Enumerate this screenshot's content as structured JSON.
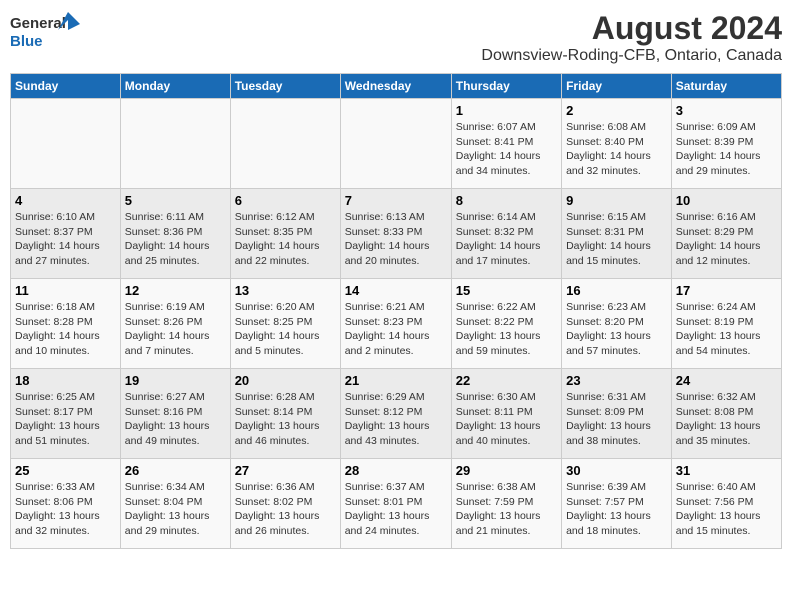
{
  "logo": {
    "line1": "General",
    "line2": "Blue"
  },
  "title": "August 2024",
  "subtitle": "Downsview-Roding-CFB, Ontario, Canada",
  "headers": [
    "Sunday",
    "Monday",
    "Tuesday",
    "Wednesday",
    "Thursday",
    "Friday",
    "Saturday"
  ],
  "weeks": [
    [
      {
        "day": "",
        "info": ""
      },
      {
        "day": "",
        "info": ""
      },
      {
        "day": "",
        "info": ""
      },
      {
        "day": "",
        "info": ""
      },
      {
        "day": "1",
        "info": "Sunrise: 6:07 AM\nSunset: 8:41 PM\nDaylight: 14 hours and 34 minutes."
      },
      {
        "day": "2",
        "info": "Sunrise: 6:08 AM\nSunset: 8:40 PM\nDaylight: 14 hours and 32 minutes."
      },
      {
        "day": "3",
        "info": "Sunrise: 6:09 AM\nSunset: 8:39 PM\nDaylight: 14 hours and 29 minutes."
      }
    ],
    [
      {
        "day": "4",
        "info": "Sunrise: 6:10 AM\nSunset: 8:37 PM\nDaylight: 14 hours and 27 minutes."
      },
      {
        "day": "5",
        "info": "Sunrise: 6:11 AM\nSunset: 8:36 PM\nDaylight: 14 hours and 25 minutes."
      },
      {
        "day": "6",
        "info": "Sunrise: 6:12 AM\nSunset: 8:35 PM\nDaylight: 14 hours and 22 minutes."
      },
      {
        "day": "7",
        "info": "Sunrise: 6:13 AM\nSunset: 8:33 PM\nDaylight: 14 hours and 20 minutes."
      },
      {
        "day": "8",
        "info": "Sunrise: 6:14 AM\nSunset: 8:32 PM\nDaylight: 14 hours and 17 minutes."
      },
      {
        "day": "9",
        "info": "Sunrise: 6:15 AM\nSunset: 8:31 PM\nDaylight: 14 hours and 15 minutes."
      },
      {
        "day": "10",
        "info": "Sunrise: 6:16 AM\nSunset: 8:29 PM\nDaylight: 14 hours and 12 minutes."
      }
    ],
    [
      {
        "day": "11",
        "info": "Sunrise: 6:18 AM\nSunset: 8:28 PM\nDaylight: 14 hours and 10 minutes."
      },
      {
        "day": "12",
        "info": "Sunrise: 6:19 AM\nSunset: 8:26 PM\nDaylight: 14 hours and 7 minutes."
      },
      {
        "day": "13",
        "info": "Sunrise: 6:20 AM\nSunset: 8:25 PM\nDaylight: 14 hours and 5 minutes."
      },
      {
        "day": "14",
        "info": "Sunrise: 6:21 AM\nSunset: 8:23 PM\nDaylight: 14 hours and 2 minutes."
      },
      {
        "day": "15",
        "info": "Sunrise: 6:22 AM\nSunset: 8:22 PM\nDaylight: 13 hours and 59 minutes."
      },
      {
        "day": "16",
        "info": "Sunrise: 6:23 AM\nSunset: 8:20 PM\nDaylight: 13 hours and 57 minutes."
      },
      {
        "day": "17",
        "info": "Sunrise: 6:24 AM\nSunset: 8:19 PM\nDaylight: 13 hours and 54 minutes."
      }
    ],
    [
      {
        "day": "18",
        "info": "Sunrise: 6:25 AM\nSunset: 8:17 PM\nDaylight: 13 hours and 51 minutes."
      },
      {
        "day": "19",
        "info": "Sunrise: 6:27 AM\nSunset: 8:16 PM\nDaylight: 13 hours and 49 minutes."
      },
      {
        "day": "20",
        "info": "Sunrise: 6:28 AM\nSunset: 8:14 PM\nDaylight: 13 hours and 46 minutes."
      },
      {
        "day": "21",
        "info": "Sunrise: 6:29 AM\nSunset: 8:12 PM\nDaylight: 13 hours and 43 minutes."
      },
      {
        "day": "22",
        "info": "Sunrise: 6:30 AM\nSunset: 8:11 PM\nDaylight: 13 hours and 40 minutes."
      },
      {
        "day": "23",
        "info": "Sunrise: 6:31 AM\nSunset: 8:09 PM\nDaylight: 13 hours and 38 minutes."
      },
      {
        "day": "24",
        "info": "Sunrise: 6:32 AM\nSunset: 8:08 PM\nDaylight: 13 hours and 35 minutes."
      }
    ],
    [
      {
        "day": "25",
        "info": "Sunrise: 6:33 AM\nSunset: 8:06 PM\nDaylight: 13 hours and 32 minutes."
      },
      {
        "day": "26",
        "info": "Sunrise: 6:34 AM\nSunset: 8:04 PM\nDaylight: 13 hours and 29 minutes."
      },
      {
        "day": "27",
        "info": "Sunrise: 6:36 AM\nSunset: 8:02 PM\nDaylight: 13 hours and 26 minutes."
      },
      {
        "day": "28",
        "info": "Sunrise: 6:37 AM\nSunset: 8:01 PM\nDaylight: 13 hours and 24 minutes."
      },
      {
        "day": "29",
        "info": "Sunrise: 6:38 AM\nSunset: 7:59 PM\nDaylight: 13 hours and 21 minutes."
      },
      {
        "day": "30",
        "info": "Sunrise: 6:39 AM\nSunset: 7:57 PM\nDaylight: 13 hours and 18 minutes."
      },
      {
        "day": "31",
        "info": "Sunrise: 6:40 AM\nSunset: 7:56 PM\nDaylight: 13 hours and 15 minutes."
      }
    ]
  ]
}
